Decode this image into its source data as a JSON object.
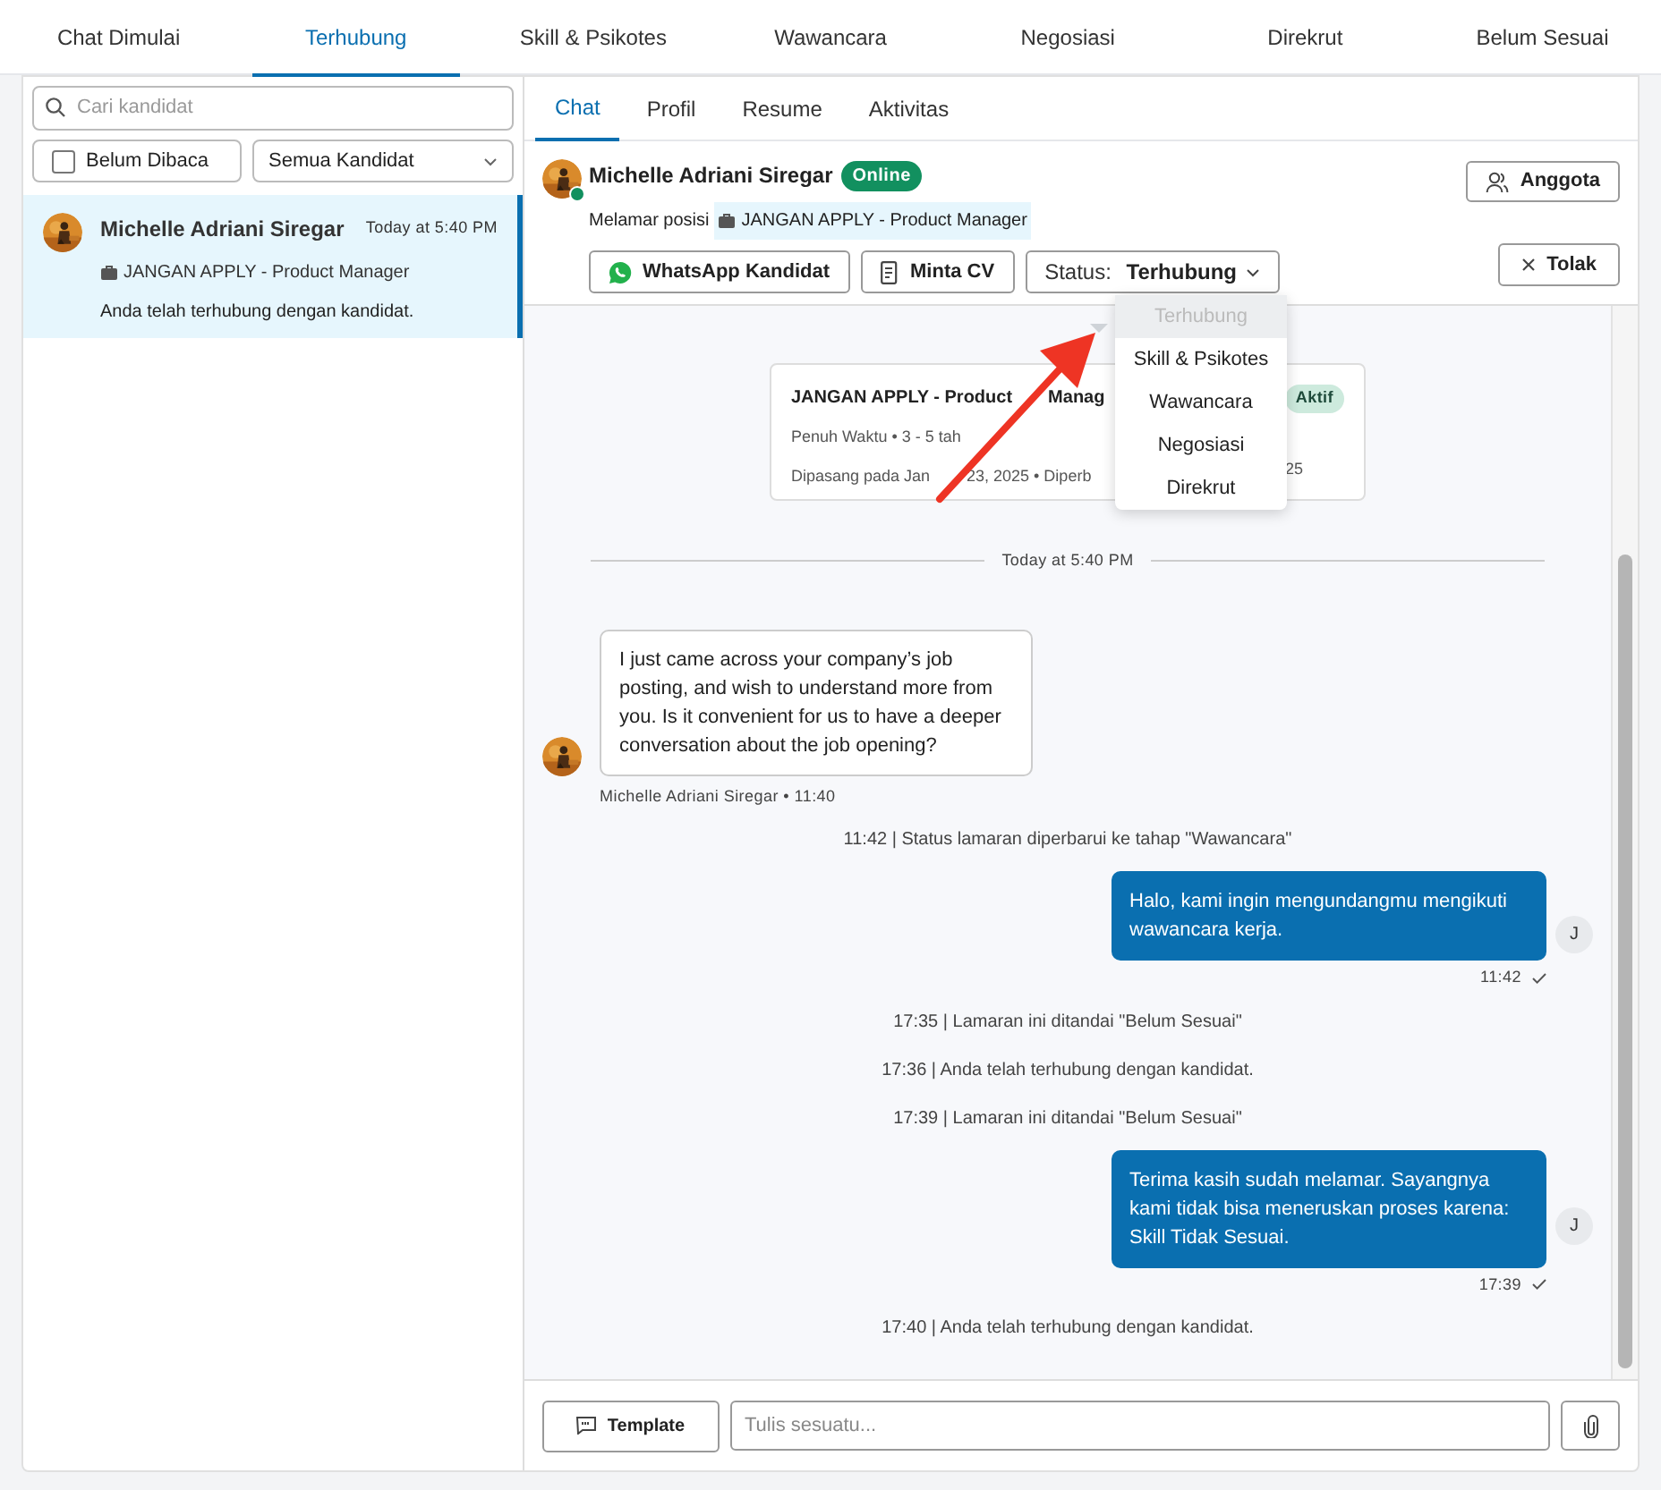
{
  "top_tabs": [
    {
      "label": "Chat Dimulai",
      "selected": false
    },
    {
      "label": "Terhubung",
      "selected": true
    },
    {
      "label": "Skill & Psikotes",
      "selected": false
    },
    {
      "label": "Wawancara",
      "selected": false
    },
    {
      "label": "Negosiasi",
      "selected": false
    },
    {
      "label": "Direkrut",
      "selected": false
    },
    {
      "label": "Belum Sesuai",
      "selected": false
    }
  ],
  "sidebar": {
    "search": {
      "placeholder": "Cari kandidat"
    },
    "unread_filter": {
      "label": "Belum Dibaca",
      "checked": false
    },
    "candidate_filter": {
      "value": "Semua Kandidat"
    },
    "conversations": [
      {
        "name": "Michelle Adriani Siregar",
        "time": "Today at 5:40 PM",
        "job": "JANGAN APPLY - Product Manager",
        "preview": "Anda telah terhubung dengan kandidat.",
        "selected": true
      }
    ]
  },
  "sub_tabs": [
    {
      "label": "Chat",
      "selected": true
    },
    {
      "label": "Profil",
      "selected": false
    },
    {
      "label": "Resume",
      "selected": false
    },
    {
      "label": "Aktivitas",
      "selected": false
    }
  ],
  "header": {
    "name": "Michelle Adriani Siregar",
    "online": true,
    "online_label": "Online",
    "applied_label": "Melamar posisi",
    "job": "JANGAN APPLY - Product Manager",
    "members_button": "Anggota",
    "whatsapp_button": "WhatsApp Kandidat",
    "cv_button": "Minta CV",
    "status_label": "Status:",
    "status_value": "Terhubung",
    "reject_button": "Tolak"
  },
  "status_menu": [
    {
      "label": "Terhubung",
      "disabled": true
    },
    {
      "label": "Skill & Psikotes",
      "disabled": false
    },
    {
      "label": "Wawancara",
      "disabled": false
    },
    {
      "label": "Negosiasi",
      "disabled": false
    },
    {
      "label": "Direkrut",
      "disabled": false
    }
  ],
  "messages": [
    {
      "kind": "job_card",
      "title": "JANGAN APPLY - Product",
      "title_cont": "Manag",
      "badge": "Aktif",
      "meta": "Penuh Waktu • 3 - 5 tah",
      "posted": "Dipasang pada Jan",
      "posted_cont": "23, 2025 • Diperb",
      "posted_tail": "25"
    },
    {
      "kind": "divider",
      "text": "Today at 5:40 PM"
    },
    {
      "kind": "incoming",
      "text": "I just came across your company’s job posting, and wish to understand more from you. Is it convenient for us to have a deeper conversation about the job opening?",
      "sender": "Michelle Adriani Siregar • 11:40"
    },
    {
      "kind": "system",
      "text": "11:42 | Status lamaran diperbarui ke tahap \"Wawancara\""
    },
    {
      "kind": "outgoing",
      "text": "Halo, kami ingin mengundangmu mengikuti wawancara kerja.",
      "avatar": "J",
      "time": "11:42",
      "read": true
    },
    {
      "kind": "system",
      "text": "17:35 | Lamaran ini ditandai \"Belum Sesuai\""
    },
    {
      "kind": "system",
      "text": "17:36 | Anda telah terhubung dengan kandidat."
    },
    {
      "kind": "system",
      "text": "17:39 | Lamaran ini ditandai \"Belum Sesuai\""
    },
    {
      "kind": "outgoing",
      "text": "Terima kasih sudah melamar. Sayangnya kami tidak bisa meneruskan proses karena: Skill Tidak Sesuai.",
      "avatar": "J",
      "time": "17:39",
      "read": true
    },
    {
      "kind": "system",
      "text": "17:40 | Anda telah terhubung dengan kandidat."
    }
  ],
  "composer": {
    "template_button": "Template",
    "placeholder": "Tulis sesuatu..."
  }
}
